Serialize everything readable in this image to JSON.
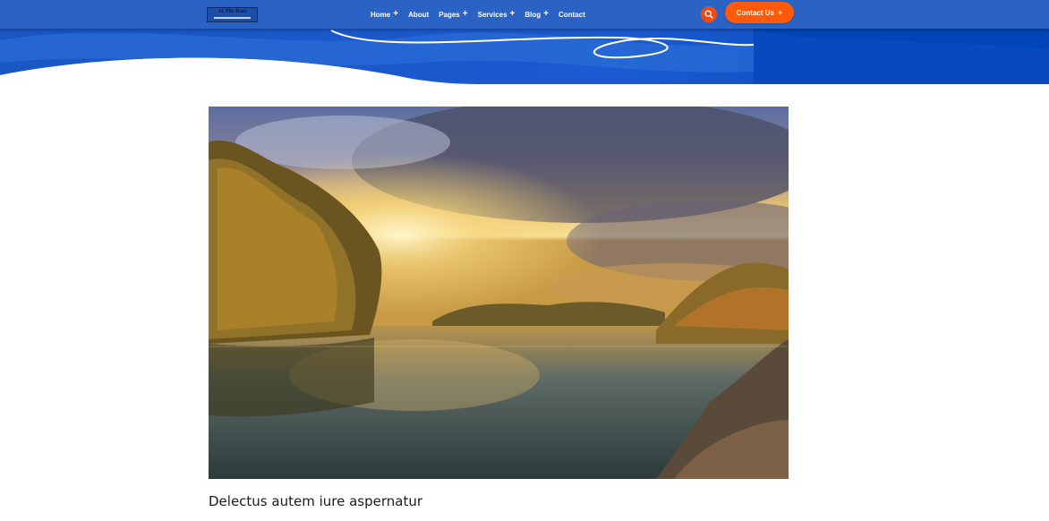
{
  "header": {
    "logo_text": "At The Rate",
    "nav_items": [
      {
        "label": "Home",
        "has_submenu": true
      },
      {
        "label": "About",
        "has_submenu": false
      },
      {
        "label": "Pages",
        "has_submenu": true
      },
      {
        "label": "Services",
        "has_submenu": true
      },
      {
        "label": "Blog",
        "has_submenu": true
      },
      {
        "label": "Contact",
        "has_submenu": false
      }
    ],
    "plus_glyph": "+",
    "search_icon": "search-icon",
    "contact_button_label": "Contact Us",
    "colors": {
      "navbar": "#2a63c4",
      "accent": "#ff5a0a",
      "hero_blue": "#0a4fc0"
    }
  },
  "main": {
    "post_title": "Delectus autem iure aspernatur"
  }
}
